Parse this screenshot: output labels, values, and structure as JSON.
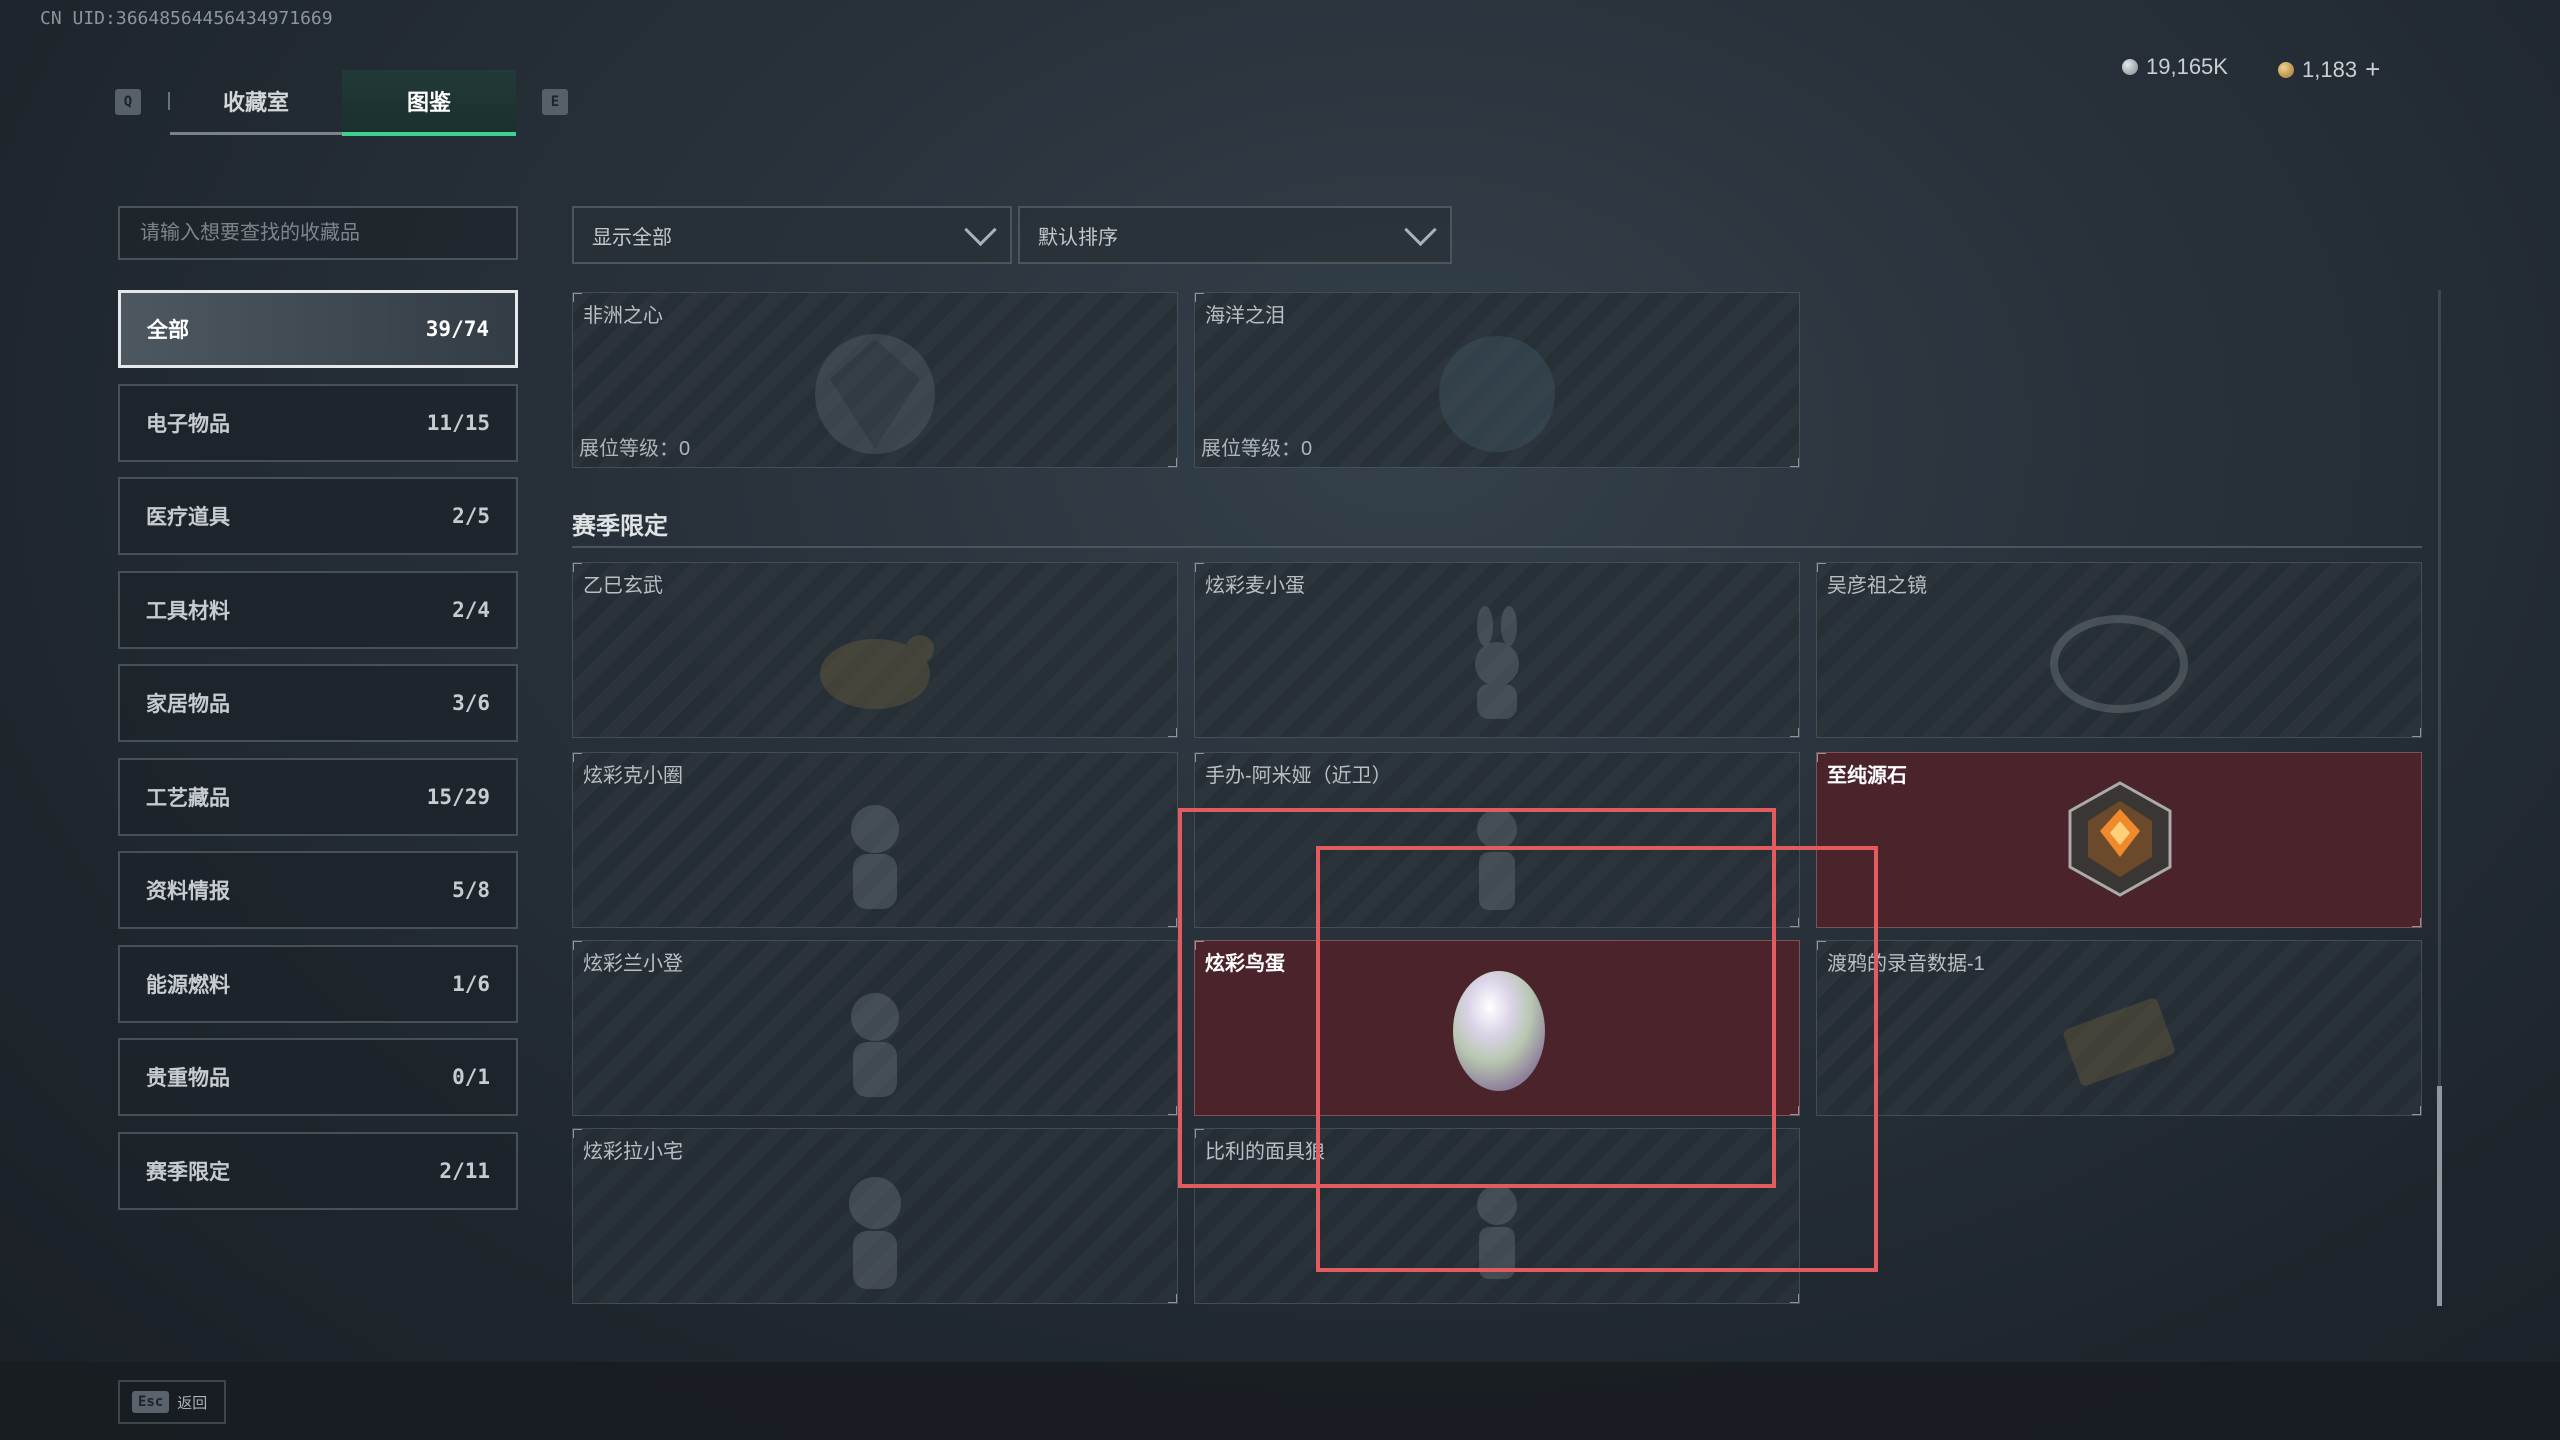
{
  "uid": "CN UID:3664856445643497​1669",
  "tabs": {
    "left_key": "Q",
    "right_key": "E",
    "items": [
      "收藏室",
      "图鉴"
    ],
    "active": 1
  },
  "currency": {
    "silver": "19,165K",
    "gold": "1,183",
    "plus": "+"
  },
  "search": {
    "placeholder": "请输入想要查找的收藏品"
  },
  "filters": {
    "show": "显示全部",
    "sort": "默认排序"
  },
  "categories": [
    {
      "label": "全部",
      "count": "39/74"
    },
    {
      "label": "电子物品",
      "count": "11/15"
    },
    {
      "label": "医疗道具",
      "count": "2/5"
    },
    {
      "label": "工具材料",
      "count": "2/4"
    },
    {
      "label": "家居物品",
      "count": "3/6"
    },
    {
      "label": "工艺藏品",
      "count": "15/29"
    },
    {
      "label": "资料情报",
      "count": "5/8"
    },
    {
      "label": "能源燃料",
      "count": "1/6"
    },
    {
      "label": "贵重物品",
      "count": "0/1"
    },
    {
      "label": "赛季限定",
      "count": "2/11"
    }
  ],
  "top_cards": [
    {
      "name": "非洲之心",
      "level": "展位等级：0"
    },
    {
      "name": "海洋之泪",
      "level": "展位等级：0"
    }
  ],
  "section_title": "赛季限定",
  "season_cards": [
    {
      "name": "乙巳玄武"
    },
    {
      "name": "炫彩麦小蛋"
    },
    {
      "name": "吴彦祖之镜"
    },
    {
      "name": "炫彩克小圈"
    },
    {
      "name": "手办-阿米娅（近卫）"
    },
    {
      "name": "至纯源石"
    },
    {
      "name": "炫彩兰小登"
    },
    {
      "name": "炫彩鸟蛋"
    },
    {
      "name": "渡鸦的录音数据-1"
    },
    {
      "name": "炫彩拉小宅"
    },
    {
      "name": "比利的面具狼"
    }
  ],
  "footer": {
    "esc_key": "Esc",
    "back": "返回"
  },
  "colors": {
    "accent": "#3fcf8e",
    "highlight": "#e25b5e",
    "owned_card": "#4a242a"
  }
}
